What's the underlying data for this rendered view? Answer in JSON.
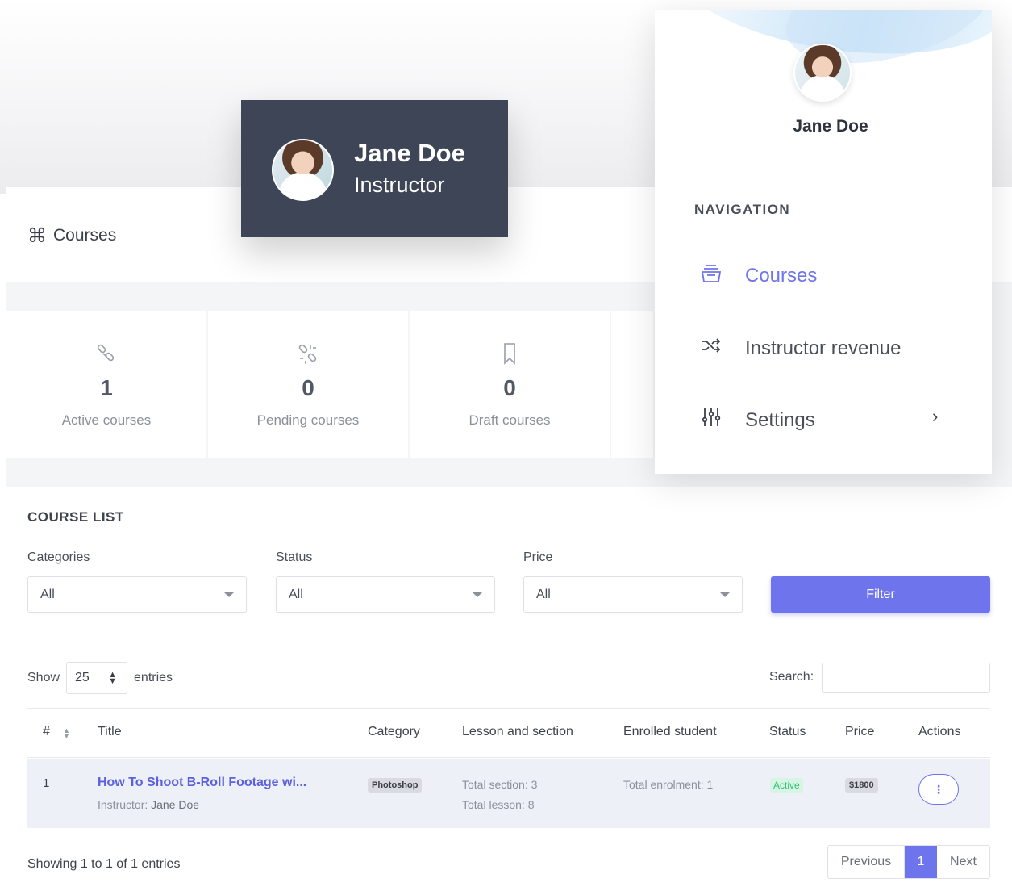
{
  "header": {
    "title": "Courses",
    "title_icon": "command-icon"
  },
  "stats": [
    {
      "icon": "links-icon",
      "value": "1",
      "label": "Active courses"
    },
    {
      "icon": "broken-link-icon",
      "value": "0",
      "label": "Pending courses"
    },
    {
      "icon": "bookmark-icon",
      "value": "0",
      "label": "Draft courses"
    }
  ],
  "course_list": {
    "title": "COURSE LIST",
    "filters": {
      "categories_label": "Categories",
      "categories_value": "All",
      "status_label": "Status",
      "status_value": "All",
      "price_label": "Price",
      "price_value": "All",
      "filter_button": "Filter"
    },
    "show_label": "Show",
    "entries_value": "25",
    "entries_label": "entries",
    "search_label": "Search:",
    "columns": [
      "#",
      "Title",
      "Category",
      "Lesson and section",
      "Enrolled student",
      "Status",
      "Price",
      "Actions"
    ],
    "rows": [
      {
        "num": "1",
        "title": "How To Shoot B-Roll Footage wi...",
        "instructor_label": "Instructor:",
        "instructor_name": "Jane Doe",
        "category": "Photoshop",
        "sections": "Total section: 3",
        "lessons": "Total lesson: 8",
        "enrolment": "Total enrolment: 1",
        "status": "Active",
        "price": "$1800",
        "actions_icon": "more-vertical-icon"
      }
    ],
    "showing_text": "Showing 1 to 1 of 1 entries",
    "pager": {
      "previous": "Previous",
      "current": "1",
      "next": "Next"
    }
  },
  "profile_card": {
    "name": "Jane Doe",
    "role": "Instructor"
  },
  "nav_panel": {
    "name": "Jane Doe",
    "heading": "NAVIGATION",
    "items": [
      {
        "label": "Courses",
        "icon": "inbox-stack-icon",
        "active": true
      },
      {
        "label": "Instructor revenue",
        "icon": "shuffle-icon",
        "active": false
      },
      {
        "label": "Settings",
        "icon": "sliders-icon",
        "active": false
      }
    ]
  },
  "colors": {
    "accent": "#6e74ec",
    "dark_card": "#3e4556",
    "success": "#36c17a"
  }
}
